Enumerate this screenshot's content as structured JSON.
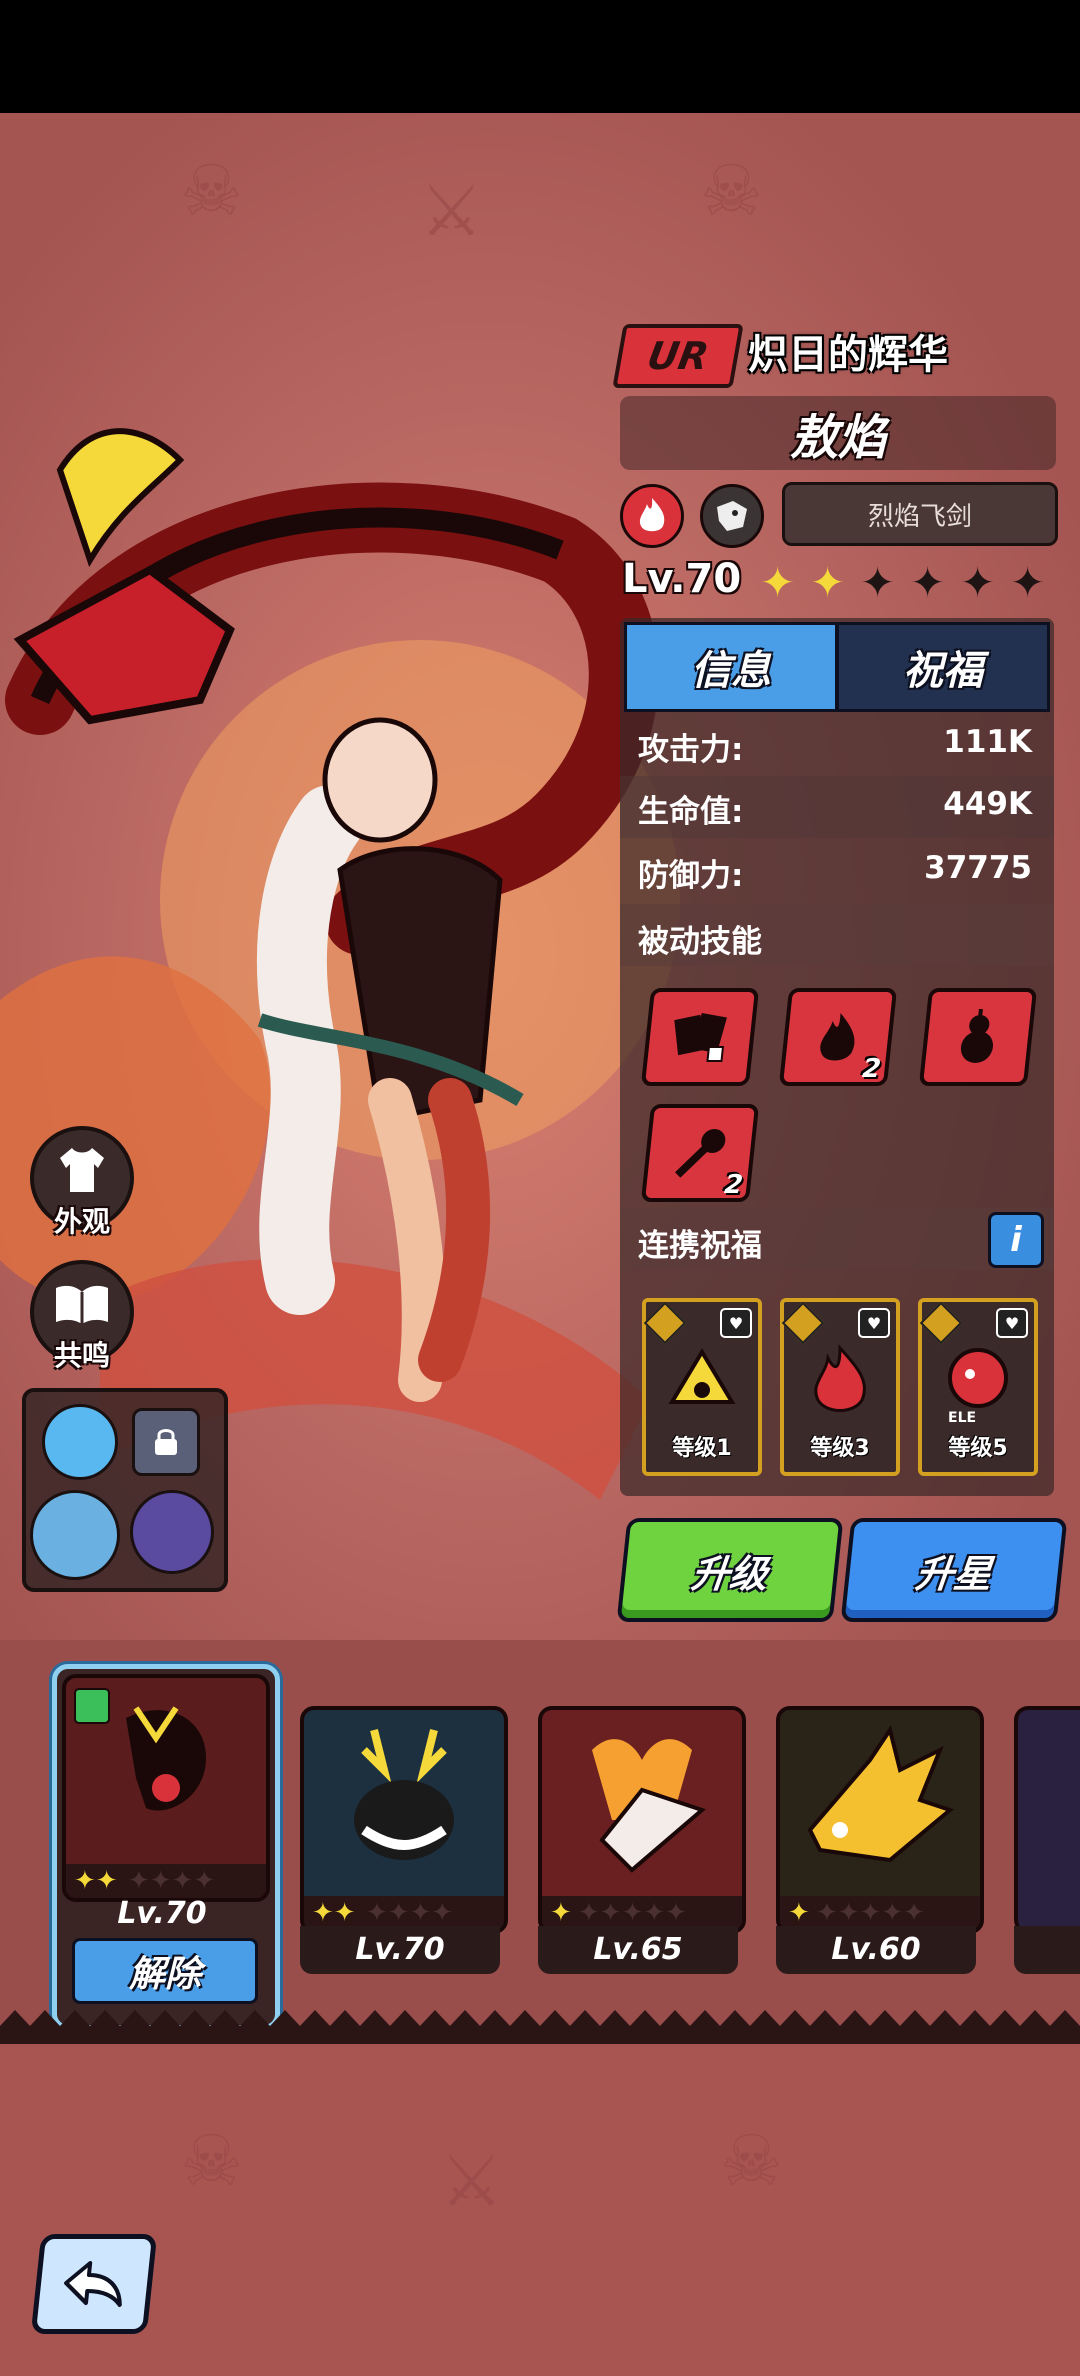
{
  "hero": {
    "rarity": "UR",
    "epithet": "炽日的辉华",
    "name": "敖焰",
    "weapon": "烈焰飞剑",
    "level": "Lv.70",
    "stars_filled": 2,
    "stars_total": 6
  },
  "tabs": {
    "info": "信息",
    "blessing": "祝福"
  },
  "stats": [
    {
      "label": "攻击力:",
      "value": "111K"
    },
    {
      "label": "生命值:",
      "value": "449K"
    },
    {
      "label": "防御力:",
      "value": "37775"
    }
  ],
  "passive": {
    "title": "被动技能",
    "skills": [
      {
        "icon": "cards-icon",
        "count": ""
      },
      {
        "icon": "fire-icon",
        "count": "2"
      },
      {
        "icon": "gourd-icon",
        "count": ""
      },
      {
        "icon": "scepter-icon",
        "count": "2"
      }
    ]
  },
  "link_blessing": {
    "title": "连携祝福",
    "info": "i",
    "cards": [
      {
        "level": "等级1",
        "icon": "lightning-creature-icon"
      },
      {
        "level": "等级3",
        "icon": "flame-spirit-icon"
      },
      {
        "level": "等级5",
        "icon": "red-beast-icon",
        "tag": "ELE"
      }
    ]
  },
  "actions": {
    "upgrade": "升级",
    "star_up": "升星"
  },
  "side": {
    "appearance": "外观",
    "resonance": "共鸣"
  },
  "roster": [
    {
      "level": "Lv.70",
      "stars": 2,
      "selected": true,
      "action": "解除"
    },
    {
      "level": "Lv.70",
      "stars": 2
    },
    {
      "level": "Lv.65",
      "stars": 1
    },
    {
      "level": "Lv.60",
      "stars": 1
    }
  ],
  "colors": {
    "accent_blue": "#4a9ee8",
    "upgrade_green": "#6fd23f",
    "ur_red": "#d9323a",
    "star_gold": "#f5d93a"
  }
}
